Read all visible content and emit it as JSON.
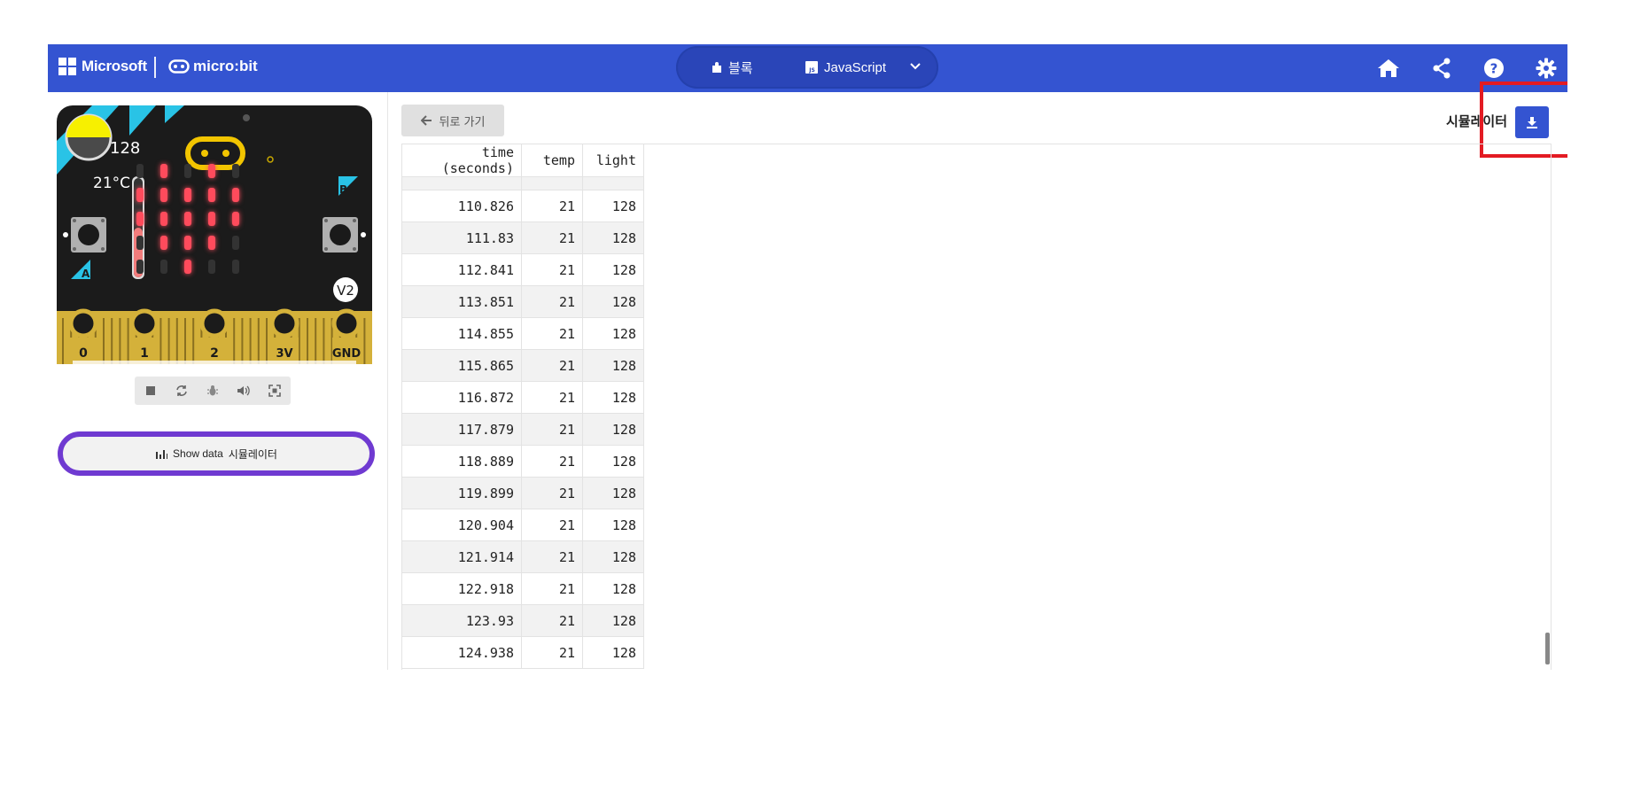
{
  "header": {
    "microsoft_label": "Microsoft",
    "microbit_label": "micro:bit",
    "tabs": [
      {
        "label": "블록",
        "icon": "puzzle-icon"
      },
      {
        "label": "JavaScript",
        "icon": "js-icon"
      }
    ],
    "icons": [
      "home-icon",
      "share-icon",
      "help-icon",
      "gear-icon"
    ]
  },
  "simulator": {
    "light_level": "128",
    "temperature": "21°C",
    "button_a": "A",
    "button_b": "B",
    "version_badge": "V2",
    "pins": [
      "0",
      "1",
      "2",
      "3V",
      "GND"
    ],
    "led_grid": [
      [
        0,
        1,
        0,
        1,
        0
      ],
      [
        1,
        1,
        1,
        1,
        1
      ],
      [
        1,
        1,
        1,
        1,
        1
      ],
      [
        0,
        1,
        1,
        1,
        0
      ],
      [
        0,
        0,
        1,
        0,
        0
      ]
    ],
    "colors": {
      "led_on": "#ff4b5c",
      "board": "#1b1b1b",
      "edge": "#d4b13a",
      "accent": "#29c3e6",
      "light_sun": "#f7f000"
    },
    "controls": [
      "stop-icon",
      "restart-icon",
      "debug-icon",
      "sound-icon",
      "fullscreen-icon"
    ],
    "show_data_label": "Show data",
    "show_data_suffix": "시뮬레이터"
  },
  "data_view": {
    "back_label": "뒤로 가기",
    "source_label": "시뮬레이터",
    "columns": [
      "time (seconds)",
      "temp",
      "light"
    ],
    "rows": [
      [
        "110.826",
        "21",
        "128"
      ],
      [
        "111.83",
        "21",
        "128"
      ],
      [
        "112.841",
        "21",
        "128"
      ],
      [
        "113.851",
        "21",
        "128"
      ],
      [
        "114.855",
        "21",
        "128"
      ],
      [
        "115.865",
        "21",
        "128"
      ],
      [
        "116.872",
        "21",
        "128"
      ],
      [
        "117.879",
        "21",
        "128"
      ],
      [
        "118.889",
        "21",
        "128"
      ],
      [
        "119.899",
        "21",
        "128"
      ],
      [
        "120.904",
        "21",
        "128"
      ],
      [
        "121.914",
        "21",
        "128"
      ],
      [
        "122.918",
        "21",
        "128"
      ],
      [
        "123.93",
        "21",
        "128"
      ],
      [
        "124.938",
        "21",
        "128"
      ]
    ]
  }
}
